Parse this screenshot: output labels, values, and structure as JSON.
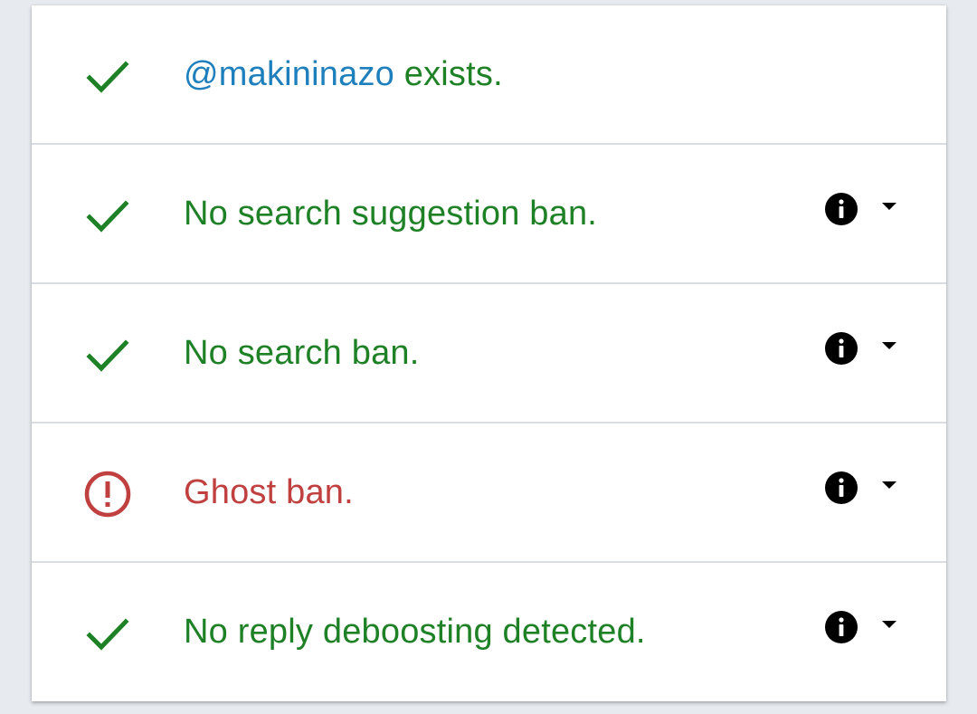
{
  "colors": {
    "ok": "#1e8126",
    "bad": "#c0403f",
    "handle": "#1e7fbd",
    "background": "#e7ebef"
  },
  "rows": [
    {
      "status": "ok",
      "icon": "check-icon",
      "handle": "@makininazo",
      "text": " exists.",
      "has_details": false
    },
    {
      "status": "ok",
      "icon": "check-icon",
      "text": "No search suggestion ban.",
      "has_details": true,
      "detail_icons": [
        "info-icon",
        "caret-down-icon"
      ]
    },
    {
      "status": "ok",
      "icon": "check-icon",
      "text": "No search ban.",
      "has_details": true,
      "detail_icons": [
        "info-icon",
        "caret-down-icon"
      ]
    },
    {
      "status": "bad",
      "icon": "alert-circle-icon",
      "text": "Ghost ban.",
      "has_details": true,
      "detail_icons": [
        "info-icon",
        "caret-down-icon"
      ]
    },
    {
      "status": "ok",
      "icon": "check-icon",
      "text": "No reply deboosting detected.",
      "has_details": true,
      "detail_icons": [
        "info-icon",
        "caret-down-icon"
      ]
    }
  ]
}
